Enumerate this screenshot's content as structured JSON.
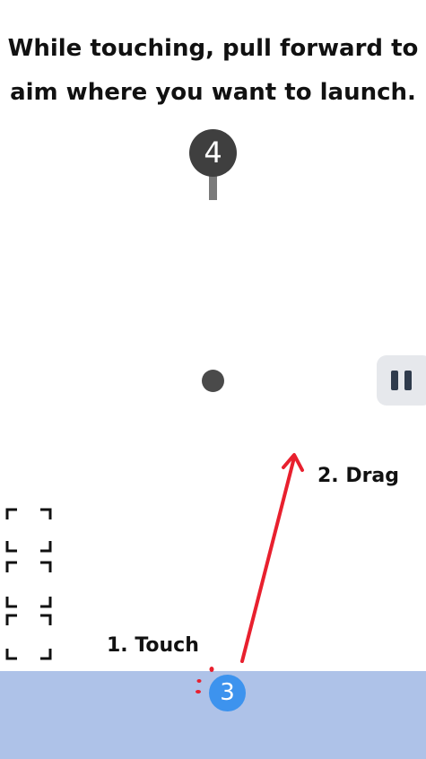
{
  "instruction": {
    "line1": "While touching, pull forward to",
    "line2": "aim where you want to launch."
  },
  "target": {
    "number": "4"
  },
  "player": {
    "number": "3"
  },
  "tutorial": {
    "step1": "1. Touch",
    "step2": "2. Drag"
  },
  "colors": {
    "ground": "#aec2e8",
    "player_ball": "#3d93ee",
    "target_badge": "#3f3f3f",
    "arrow": "#e8202e",
    "pause_button": "#e6e8ec"
  },
  "icons": {
    "pause": "pause-icon",
    "frame_corners": "frame-corners-icon",
    "arrow": "drag-arrow-icon"
  }
}
